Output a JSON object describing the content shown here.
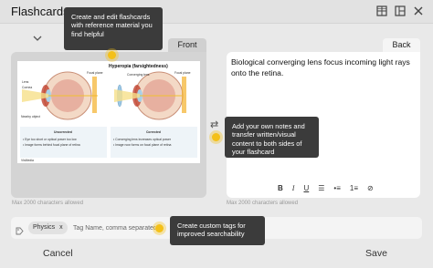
{
  "window": {
    "title": "Flashcards",
    "icons": [
      "grid-icon",
      "layout-icon",
      "close-icon"
    ]
  },
  "tabs": {
    "front": "Front",
    "back": "Back"
  },
  "front": {
    "diagram": {
      "title": "Hyperopia (farsightedness)",
      "labels": {
        "lens": "Lens",
        "cornea": "Cornea",
        "focal_plane_left": "Focal plane",
        "focal_plane_right": "Focal plane",
        "converging_lens": "Converging lens",
        "nearby_object": "Nearby object"
      },
      "uncorrected": {
        "heading": "Uncorrected",
        "bullets": [
          "• Eye too short or optical power too low",
          "• Image forms behind focal plane of retina"
        ]
      },
      "corrected": {
        "heading": "Corrected",
        "bullets": [
          "• Converging lens increases optical power",
          "• Image now forms on focal plane of retina"
        ]
      },
      "credit": "VisMedia"
    },
    "max_chars": "Max 2000 characters allowed"
  },
  "back": {
    "text": "Biological converging lens focus incoming light rays onto the retina.",
    "format_buttons": {
      "bold": "B",
      "italic": "I",
      "underline": "U",
      "list": "☰",
      "bullets": "•≡",
      "numbers": "1≡",
      "clear": "⊘"
    },
    "max_chars": "Max 2000 characters allowed"
  },
  "tags": {
    "chips": [
      {
        "label": "Physics",
        "remove": "x"
      }
    ],
    "placeholder": "Tag Name, comma separated"
  },
  "actions": {
    "cancel": "Cancel",
    "save": "Save"
  },
  "tooltips": {
    "reference": "Create and edit flashcards with reference material you find helpful",
    "notes": "Add your own notes and transfer written/visual content to both sides of your flashcard",
    "tags": "Create custom tags for improved searchability"
  },
  "colors": {
    "tooltip_bg": "#3b3b3b",
    "dot": "#f4c018",
    "iris": "#c0412e"
  }
}
